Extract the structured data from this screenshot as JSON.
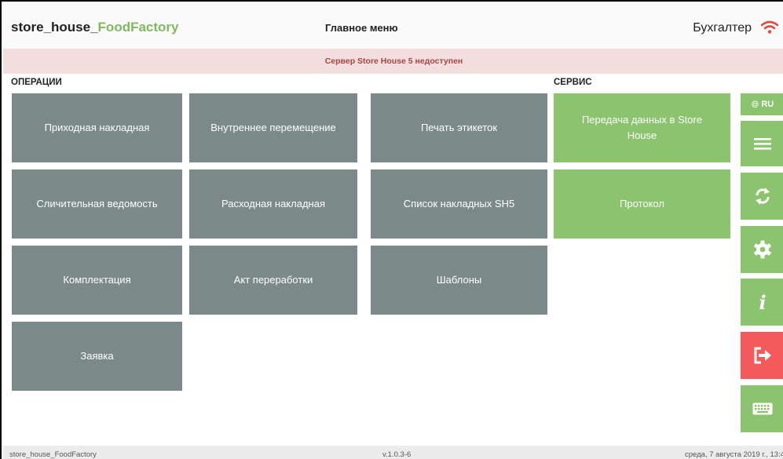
{
  "header": {
    "app_name_prefix": "store_house_",
    "app_name_accent": "FoodFactory",
    "page_title": "Главное меню",
    "user_role": "Бухгалтер"
  },
  "alert": {
    "message": "Сервер Store House 5 недоступен"
  },
  "sections": {
    "operations": "ОПЕРАЦИИ",
    "service": "СЕРВИС"
  },
  "operations": [
    "Приходная накладная",
    "Внутреннее перемещение",
    "Печать этикеток",
    "Сличительная ведомость",
    "Расходная накладная",
    "Список накладных SH5",
    "Комплектация",
    "Акт переработки",
    "Шаблоны",
    "Заявка"
  ],
  "service": [
    "Передача данных в Store House",
    "Протокол"
  ],
  "sidebar": {
    "language_label": "RU"
  },
  "footer": {
    "app_name": "store_house_FoodFactory",
    "version": "v.1.0.3-6",
    "datetime": "среда, 7 августа 2019 г., 13:4"
  },
  "colors": {
    "tile": "#7b8a89",
    "service": "#8cc36f",
    "logout": "#f55a5a",
    "alert_bg": "#f2dede",
    "alert_text": "#a94442"
  },
  "icons": [
    "wifi-icon",
    "globe-icon",
    "menu-icon",
    "sync-icon",
    "gear-icon",
    "info-icon",
    "logout-icon",
    "keyboard-icon"
  ]
}
